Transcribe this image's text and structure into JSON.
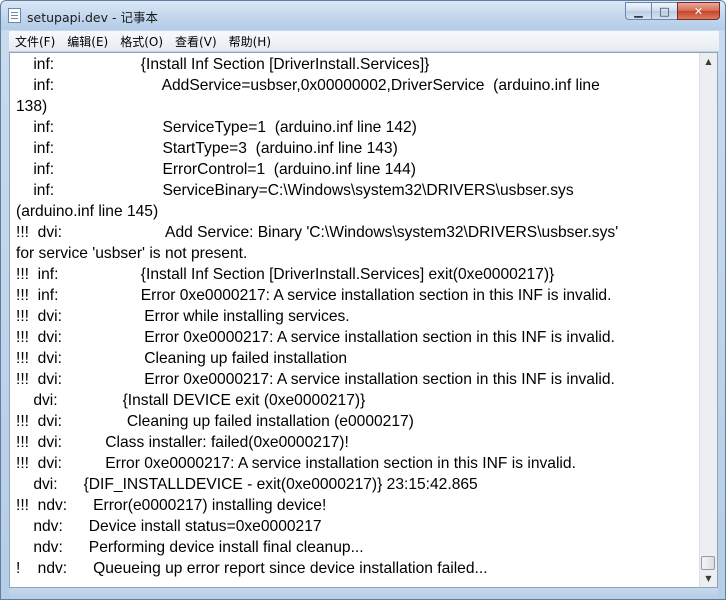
{
  "window": {
    "title": "setupapi.dev - 记事本",
    "controls": {
      "minimize": "▁",
      "maximize": "□",
      "close": "✕"
    }
  },
  "menu": [
    {
      "label": "文件(F)"
    },
    {
      "label": "编辑(E)"
    },
    {
      "label": "格式(O)"
    },
    {
      "label": "查看(V)"
    },
    {
      "label": "帮助(H)"
    }
  ],
  "lines": [
    "    inf:                    {Install Inf Section [DriverInstall.Services]}",
    "    inf:                         AddService=usbser,0x00000002,DriverService  (arduino.inf line",
    "138)",
    "    inf:                         ServiceType=1  (arduino.inf line 142)",
    "    inf:                         StartType=3  (arduino.inf line 143)",
    "    inf:                         ErrorControl=1  (arduino.inf line 144)",
    "    inf:                         ServiceBinary=C:\\Windows\\system32\\DRIVERS\\usbser.sys",
    "(arduino.inf line 145)",
    "!!!  dvi:                        Add Service: Binary 'C:\\Windows\\system32\\DRIVERS\\usbser.sys'",
    "for service 'usbser' is not present.",
    "!!!  inf:                   {Install Inf Section [DriverInstall.Services] exit(0xe0000217)}",
    "!!!  inf:                   Error 0xe0000217: A service installation section in this INF is invalid.",
    "!!!  dvi:                   Error while installing services.",
    "!!!  dvi:                   Error 0xe0000217: A service installation section in this INF is invalid.",
    "!!!  dvi:                   Cleaning up failed installation",
    "!!!  dvi:                   Error 0xe0000217: A service installation section in this INF is invalid.",
    "    dvi:               {Install DEVICE exit (0xe0000217)}",
    "!!!  dvi:               Cleaning up failed installation (e0000217)",
    "!!!  dvi:          Class installer: failed(0xe0000217)!",
    "!!!  dvi:          Error 0xe0000217: A service installation section in this INF is invalid.",
    "    dvi:      {DIF_INSTALLDEVICE - exit(0xe0000217)} 23:15:42.865",
    "!!!  ndv:      Error(e0000217) installing device!",
    "    ndv:      Device install status=0xe0000217",
    "    ndv:      Performing device install final cleanup...",
    "!    ndv:      Queueing up error report since device installation failed..."
  ],
  "scrollbar": {
    "up": "▲",
    "down": "▼"
  }
}
